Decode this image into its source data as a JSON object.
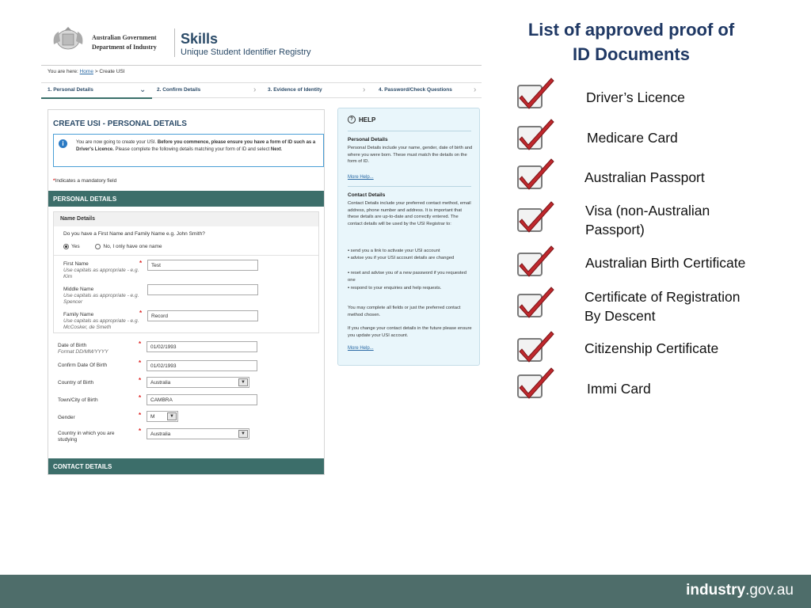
{
  "screenshot": {
    "gov_line1": "Australian Government",
    "gov_line2": "Department of Industry",
    "brand": "Skills",
    "brand_sub": "Unique Student Identifier Registry",
    "breadcrumb": {
      "prefix": "You are here:",
      "home": "Home",
      "sep": ">",
      "current": "Create USI"
    },
    "steps": [
      {
        "label": "1.   Personal Details"
      },
      {
        "label": "2.   Confirm Details"
      },
      {
        "label": "3.   Evidence of Identity"
      },
      {
        "label": "4.   Password/Check Questions"
      }
    ],
    "form_title": "CREATE USI - PERSONAL DETAILS",
    "info_text_a": "You are now going to create your USI.",
    "info_text_b": "Before you commence, please ensure you have a form of ID such as a Driver's Licence.",
    "info_text_c": "Please complete the following details matching your form of ID and select",
    "info_text_d": "Next",
    "mandatory_note": "Indicates a mandatory field",
    "personal_bar": "PERSONAL DETAILS",
    "name_details": "Name Details",
    "name_question": "Do you have a First Name and Family Name e.g. John Smith?",
    "radio_yes": "Yes",
    "radio_no": "No, I only have one name",
    "first_name_label": "First Name",
    "first_name_hint": "Use capitals as appropriate - e.g. Kim",
    "first_name_value": "Test",
    "middle_name_label": "Middle Name",
    "middle_name_hint": "Use capitals as appropriate - e.g. Spencer",
    "middle_name_value": "",
    "family_name_label": "Family Name",
    "family_name_hint": "Use capitals as appropriate - e.g. McCosker, de Smeth",
    "family_name_value": "Record",
    "dob_label": "Date of Birth",
    "dob_hint": "Format DD/MM/YYYY",
    "dob_value": "01/02/1993",
    "confirm_dob_label": "Confirm Date Of Birth",
    "confirm_dob_value": "01/02/1993",
    "country_birth_label": "Country of Birth",
    "country_birth_value": "Australia",
    "town_birth_label": "Town/City of Birth",
    "town_birth_value": "CAMBRA",
    "gender_label": "Gender",
    "gender_value": "M",
    "country_study_label": "Country in which you are studying",
    "country_study_value": "Australia",
    "contact_bar": "CONTACT DETAILS",
    "help": {
      "title": "HELP",
      "personal_heading": "Personal Details",
      "personal_text": "Personal Details include your name, gender, date of birth and where you were born. These must match the details on the form of ID.",
      "more_help_1": "More Help...",
      "contact_heading": "Contact Details",
      "contact_text": "Contact Details include your preferred contact method, email address, phone number and address. It is important that these details are up-to-date and correctly entered. The contact details will be used by the USI Registrar to:",
      "bullet1": "send you a link to activate your USI account",
      "bullet2": "advise you if your USI account details are changed",
      "bullet3": "reset and advise you of a new password if you requested one",
      "bullet4": "respond to your enquiries and help requests.",
      "complete_text": "You may complete all fields or just the preferred contact method chosen.",
      "change_text": "If you change your contact details in the future please ensure you update your USI account.",
      "more_help_2": "More Help..."
    }
  },
  "list": {
    "title_line1": "List of approved proof of",
    "title_line2": "ID Documents",
    "items": [
      {
        "label": "Driver’s Licence"
      },
      {
        "label": "Medicare Card"
      },
      {
        "label": "Australian Passport"
      },
      {
        "label": "Visa (non-Australian",
        "label2": "Passport)"
      },
      {
        "label": "Australian Birth Certificate"
      },
      {
        "label": "Certificate of Registration",
        "label2": "By Descent"
      },
      {
        "label": "Citizenship Certificate"
      },
      {
        "label": "Immi Card"
      }
    ]
  },
  "footer": {
    "logo_bold": "industry",
    "logo_rest": ".gov.au"
  },
  "colors": {
    "title": "#1f3864",
    "footer": "#4e6d6a",
    "bar": "#3c6e6a",
    "check_red": "#c0282d"
  },
  "icons": [
    "crest-icon",
    "info-icon",
    "help-icon",
    "checkmark-icon",
    "chevron-down-icon",
    "chevron-right-icon"
  ]
}
